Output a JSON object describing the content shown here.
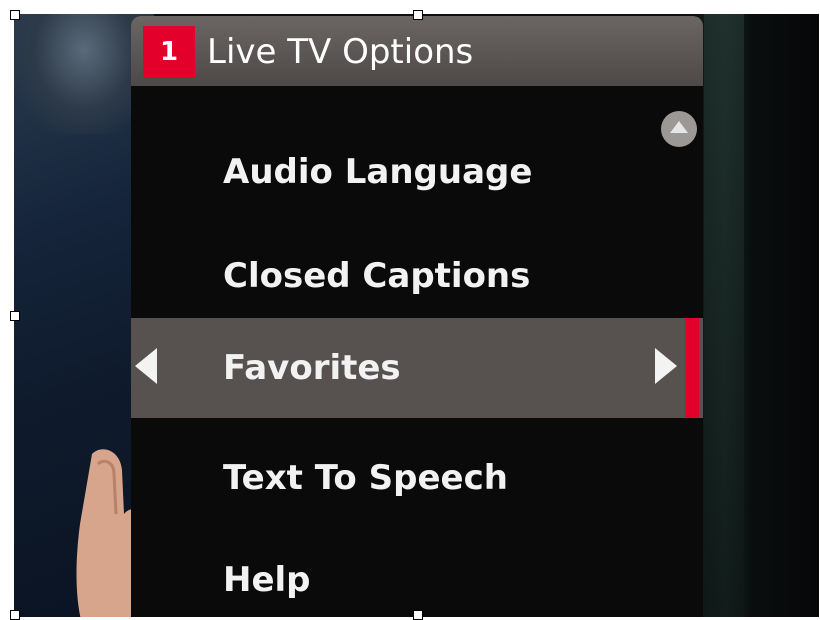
{
  "header": {
    "channel_badge": "1",
    "title": "Live TV Options"
  },
  "menu": {
    "items": [
      {
        "label": "Audio Language"
      },
      {
        "label": "Closed Captions"
      },
      {
        "label": "Favorites",
        "selected": true
      },
      {
        "label": "Text To Speech"
      },
      {
        "label": "Help"
      }
    ]
  },
  "icons": {
    "scroll_up": "chevron-up-icon",
    "nav_left": "arrow-left-icon",
    "nav_right": "arrow-right-icon"
  },
  "colors": {
    "accent": "#e3002b",
    "header_bg": "#5c5655",
    "selected_bg": "#575250",
    "panel_bg": "#0b0a0a"
  }
}
